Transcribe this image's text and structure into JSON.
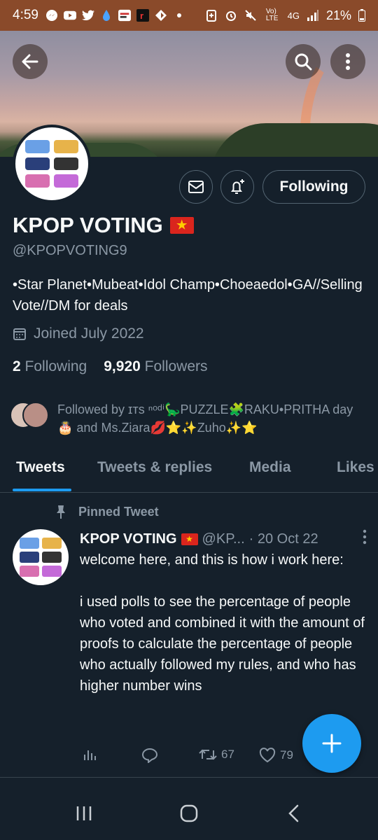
{
  "status_bar": {
    "time": "4:59",
    "battery": "21%",
    "network": "4G"
  },
  "profile": {
    "name": "KPOP VOTING",
    "handle": "@KPOPVOTING9",
    "bio": "•Star Planet•Mubeat•Idol Champ•Choeaedol•GA//Selling Vote//DM for deals",
    "joined": "Joined July 2022",
    "following_count": "2",
    "following_label": "Following",
    "followers_count": "9,920",
    "followers_label": "Followers",
    "follow_button": "Following",
    "followed_by": "Followed by ɪᴛs ⁿᵒᵈⁱ🦕PUZZLE🧩RAKU•PRITHA day 🎂 and Ms.Ziara💋⭐✨Zuho✨⭐"
  },
  "tabs": [
    {
      "label": "Tweets"
    },
    {
      "label": "Tweets & replies"
    },
    {
      "label": "Media"
    },
    {
      "label": "Likes"
    }
  ],
  "tweet": {
    "pinned_label": "Pinned Tweet",
    "author_name": "KPOP VOTING",
    "author_handle": "@KP...",
    "date": "· 20 Oct 22",
    "body": "welcome here, and this is how i work here:\n\ni used polls to see the percentage of people who voted and combined it with the amount of proofs to calculate the percentage of people who actually followed my rules, and who has higher number wins",
    "retweets": "67",
    "likes": "79"
  },
  "colors": {
    "background": "#15202b",
    "accent": "#1d9bf0",
    "muted_text": "#8b98a5"
  }
}
